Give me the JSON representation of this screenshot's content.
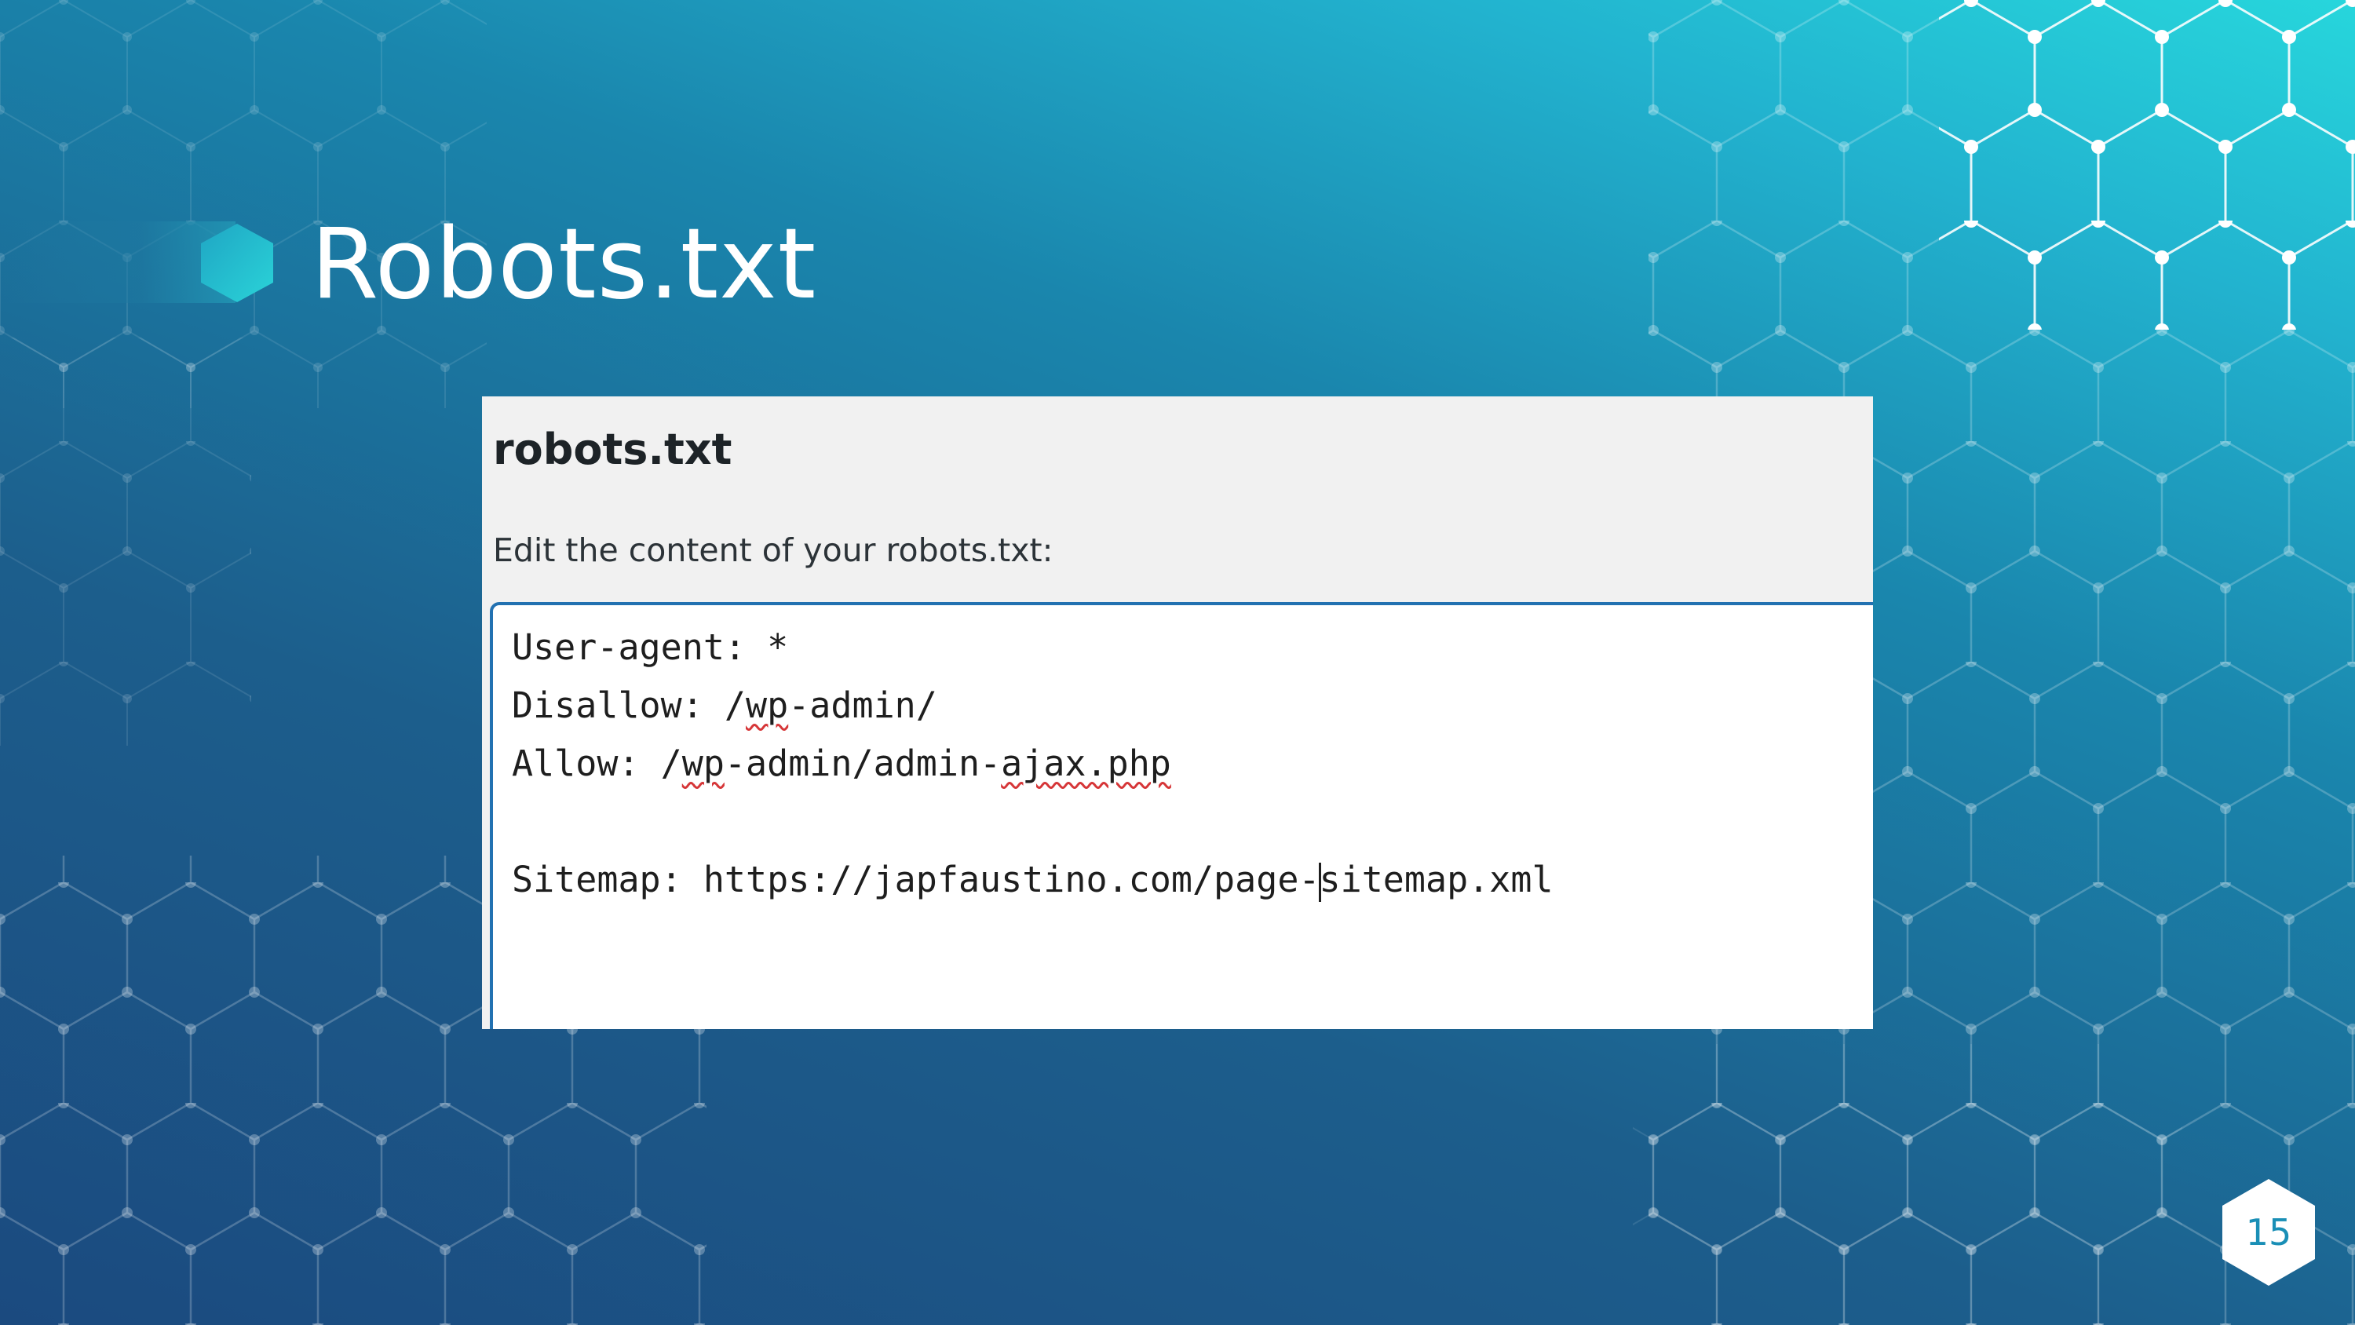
{
  "slide": {
    "title": "Robots.txt",
    "page_number": "15"
  },
  "panel": {
    "heading": "robots.txt",
    "description": "Edit the content of your robots.txt:"
  },
  "editor": {
    "line1": "User-agent: *",
    "line2_prefix": "Disallow: /",
    "line2_wp": "wp",
    "line2_suffix": "-admin/",
    "line3_prefix": "Allow: /",
    "line3_wp": "wp",
    "line3_mid": "-admin/admin-",
    "line3_ajax": "ajax.php",
    "line4": "",
    "line5_before_caret": "Sitemap: https://japfaustino.com/page-",
    "line5_after_caret": "sitemap.xml"
  },
  "colors": {
    "editor_border": "#2271b1",
    "spellcheck_underline": "#d63638",
    "page_number_text": "#1a8fb6"
  }
}
